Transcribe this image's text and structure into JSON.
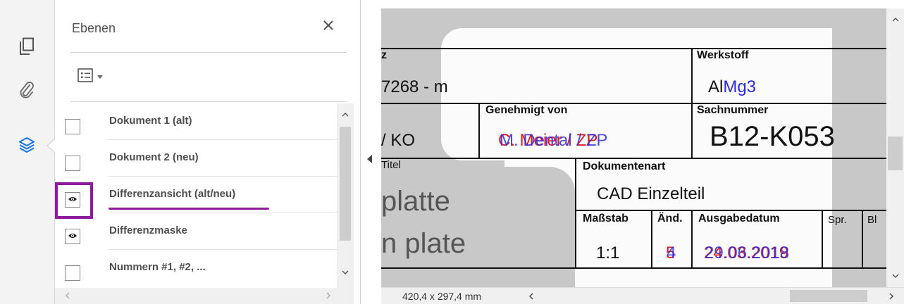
{
  "rail": {
    "items": [
      {
        "name": "pages-icon"
      },
      {
        "name": "attachments-icon"
      },
      {
        "name": "layers-icon",
        "active": true
      }
    ],
    "active_color": "#1473e6"
  },
  "panel": {
    "title": "Ebenen",
    "layers": [
      {
        "label": "Dokument 1 (alt)",
        "visible": false
      },
      {
        "label": "Dokument 2 (neu)",
        "visible": false
      },
      {
        "label": "Differenzansicht (alt/neu)",
        "visible": true,
        "highlighted": true
      },
      {
        "label": "Differenzmaske",
        "visible": true
      },
      {
        "label": "Nummern #1, #2, ...",
        "visible": false
      }
    ],
    "highlight_color": "#8e1b9c"
  },
  "document": {
    "col1_header": "z",
    "part_number_fragment": "7268 - m",
    "ko_fragment": "/ KO",
    "titel_header": "Titel",
    "title_de_fragment": "platte",
    "title_en_fragment": "n plate",
    "genehmigt_header": "Genehmigt von",
    "genehmigt_old": "C. Meier / ZP",
    "genehmigt_new": "M. Dental / ZP",
    "werkstoff_header": "Werkstoff",
    "werkstoff_old": "Al",
    "werkstoff_new": "Mg3",
    "sachnummer_header": "Sachnummer",
    "sachnummer_value": "B12-K053",
    "dokumentenart_header": "Dokumentenart",
    "dokumentenart_value": "CAD Einzelteil",
    "massstab_header": "Maßstab",
    "massstab_value": "1:1",
    "aend_header": "Änd.",
    "aend_old": "5",
    "aend_new": "4",
    "ausgabe_header": "Ausgabedatum",
    "ausgabe_old": "24.03.2019",
    "ausgabe_new": "29.06.2018",
    "spr_header": "Spr.",
    "bl_header": "Bl"
  },
  "status": {
    "page_size": "420,4 x 297,4 mm"
  }
}
